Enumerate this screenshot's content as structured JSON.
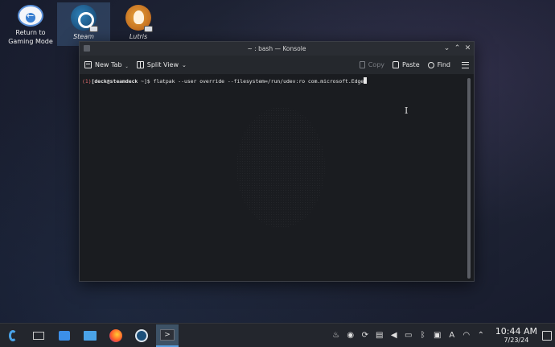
{
  "desktop": {
    "icons": [
      {
        "label": "Return to\nGaming Mode",
        "icon": "return-icon"
      },
      {
        "label": "Steam",
        "icon": "steam-icon"
      },
      {
        "label": "Lutris",
        "icon": "lutris-icon"
      }
    ]
  },
  "window": {
    "title": "~ : bash — Konsole",
    "toolbar": {
      "new_tab": "New Tab",
      "split_view": "Split View",
      "copy": "Copy",
      "paste": "Paste",
      "find": "Find"
    },
    "terminal": {
      "exit_code": "(1)",
      "user_host": "[deck@steamdeck",
      "path_suffix": " ~]$ ",
      "command": "flatpak --user override --filesystem=/run/udev:ro com.microsoft.Edge"
    }
  },
  "taskbar": {
    "clock_time": "10:44 AM",
    "clock_date": "7/23/24"
  },
  "colors": {
    "accent": "#4aa3e8",
    "error": "#e06c6c"
  }
}
